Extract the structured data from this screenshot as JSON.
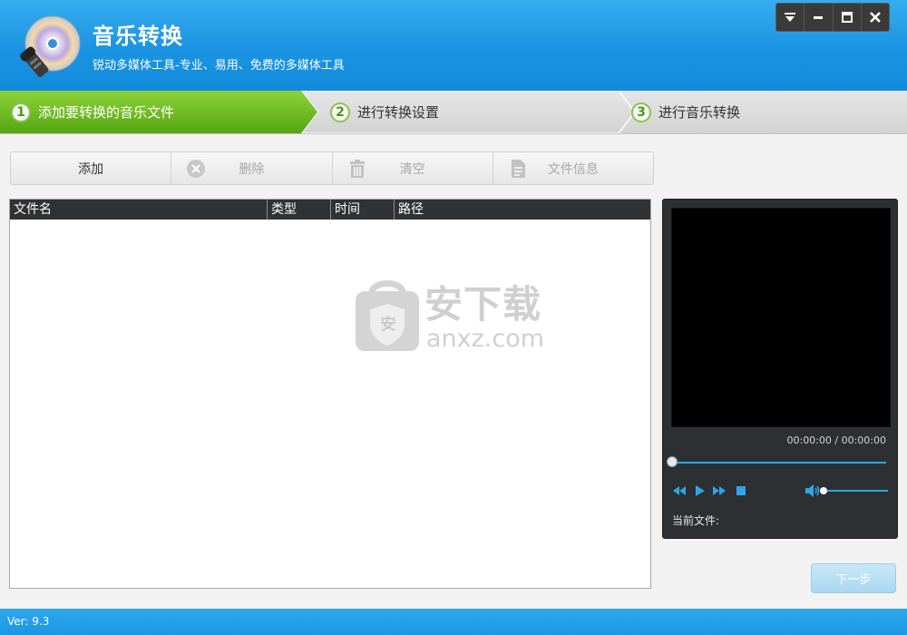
{
  "app": {
    "title": "音乐转换",
    "subtitle": "锐动多媒体工具-专业、易用、免费的多媒体工具"
  },
  "steps": [
    {
      "num": "1",
      "label": "添加要转换的音乐文件",
      "active": true
    },
    {
      "num": "2",
      "label": "进行转换设置",
      "active": false
    },
    {
      "num": "3",
      "label": "进行音乐转换",
      "active": false
    }
  ],
  "toolbar": {
    "add": "添加",
    "delete": "删除",
    "clear": "清空",
    "file_info": "文件信息"
  },
  "file_list": {
    "columns": [
      "文件名",
      "类型",
      "时间",
      "路径"
    ],
    "rows": []
  },
  "watermark": {
    "brand": "安下载",
    "domain": "anxz.com",
    "badge": "安"
  },
  "player": {
    "timecode": "00:00:00 / 00:00:00",
    "current_file_label": "当前文件:",
    "progress": 0
  },
  "next_button": "下一步",
  "status": {
    "version": "Ver: 9.3"
  },
  "colors": {
    "header_blue": "#1a94e2",
    "active_step_green": "#6fbf1a",
    "progress_blue": "#2ba6e8",
    "player_bg": "#2d3032"
  }
}
